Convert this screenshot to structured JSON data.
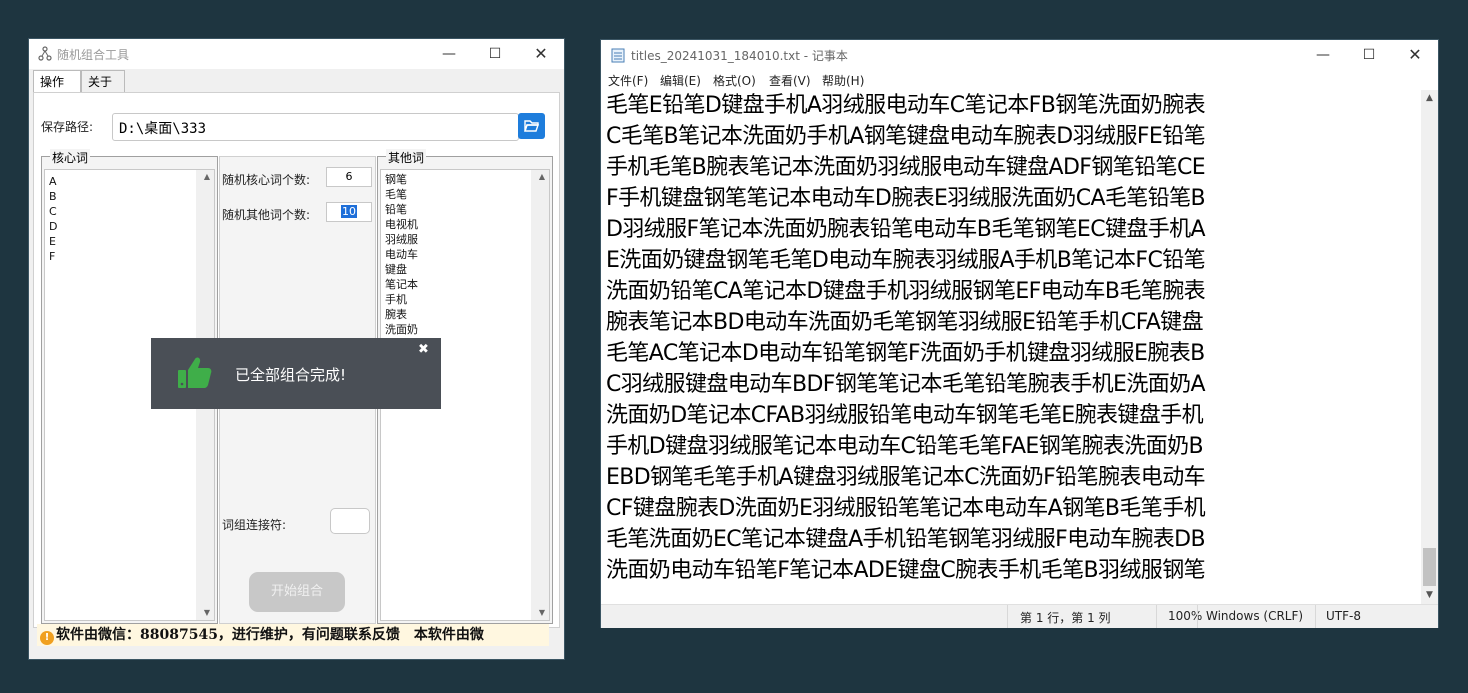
{
  "app": {
    "title": "随机组合工具",
    "tabs": [
      "操作",
      "关于"
    ],
    "save_path_label": "保存路径:",
    "save_path_value": "D:\\桌面\\333",
    "core_group_label": "核心词",
    "core_words": [
      "A",
      "B",
      "C",
      "D",
      "E",
      "F"
    ],
    "core_count_label": "随机核心词个数:",
    "core_count_value": "6",
    "other_count_label": "随机其他词个数:",
    "other_count_value": "10",
    "connector_label": "词组连接符:",
    "connector_value": "",
    "start_button": "开始组合",
    "other_group_label": "其他词",
    "other_words": [
      "钢笔",
      "毛笔",
      "铅笔",
      "电视机",
      "羽绒服",
      "电动车",
      "键盘",
      "笔记本",
      "手机",
      "腕表",
      "洗面奶"
    ],
    "toast_message": "已全部组合完成!",
    "status_text": "软件由微信：88087545，进行维护，有问题联系反馈　本软件由微",
    "colors": {
      "toast_bg": "#4a4f56",
      "thumb": "#3fae49",
      "folder_button": "#1e7ddc",
      "status_bg": "#fff7e0"
    }
  },
  "notepad": {
    "title": "titles_20241031_184010.txt - 记事本",
    "menu": [
      "文件(F)",
      "编辑(E)",
      "格式(O)",
      "查看(V)",
      "帮助(H)"
    ],
    "lines": [
      "毛笔E铅笔D键盘手机A羽绒服电动车C笔记本FB钢笔洗面奶腕表",
      "C毛笔B笔记本洗面奶手机A钢笔键盘电动车腕表D羽绒服FE铅笔",
      "手机毛笔B腕表笔记本洗面奶羽绒服电动车键盘ADF钢笔铅笔CE",
      "F手机键盘钢笔笔记本电动车D腕表E羽绒服洗面奶CA毛笔铅笔B",
      "D羽绒服F笔记本洗面奶腕表铅笔电动车B毛笔钢笔EC键盘手机A",
      "E洗面奶键盘钢笔毛笔D电动车腕表羽绒服A手机B笔记本FC铅笔",
      "洗面奶铅笔CA笔记本D键盘手机羽绒服钢笔EF电动车B毛笔腕表",
      "腕表笔记本BD电动车洗面奶毛笔钢笔羽绒服E铅笔手机CFA键盘",
      "毛笔AC笔记本D电动车铅笔钢笔F洗面奶手机键盘羽绒服E腕表B",
      "C羽绒服键盘电动车BDF钢笔笔记本毛笔铅笔腕表手机E洗面奶A",
      "洗面奶D笔记本CFAB羽绒服铅笔电动车钢笔毛笔E腕表键盘手机",
      "手机D键盘羽绒服笔记本电动车C铅笔毛笔FAE钢笔腕表洗面奶B",
      "EBD钢笔毛笔手机A键盘羽绒服笔记本C洗面奶F铅笔腕表电动车",
      "CF键盘腕表D洗面奶E羽绒服铅笔笔记本电动车A钢笔B毛笔手机",
      "毛笔洗面奶EC笔记本键盘A手机铅笔钢笔羽绒服F电动车腕表DB",
      "洗面奶电动车铅笔F笔记本ADE键盘C腕表手机毛笔B羽绒服钢笔"
    ],
    "status": {
      "position": "第 1 行，第 1 列",
      "zoom": "100%",
      "eol": "Windows (CRLF)",
      "encoding": "UTF-8"
    }
  }
}
